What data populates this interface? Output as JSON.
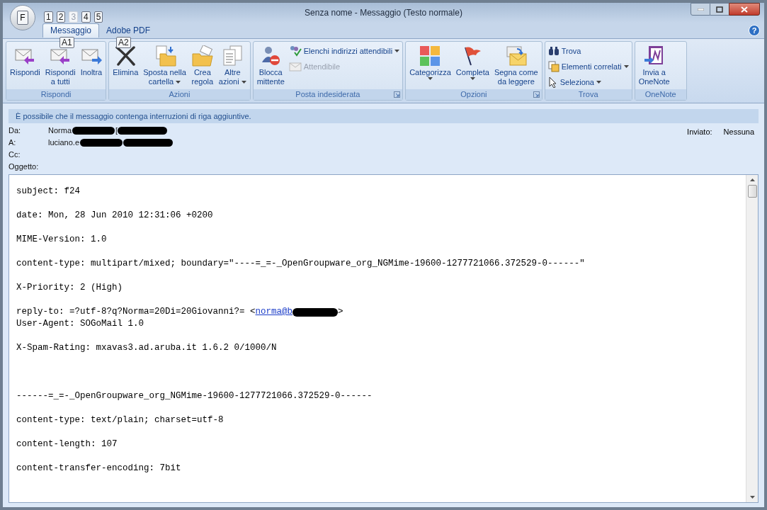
{
  "window": {
    "title": "Senza nome - Messaggio (Testo normale)",
    "office_button_keytip": "F",
    "quick_access_keytips": [
      {
        "label": "1",
        "disabled": false
      },
      {
        "label": "2",
        "disabled": false
      },
      {
        "label": "3",
        "disabled": true
      },
      {
        "label": "4",
        "disabled": false
      },
      {
        "label": "5",
        "disabled": false
      }
    ]
  },
  "tabs": [
    {
      "label": "Messaggio",
      "selected": true,
      "keytip": "A1"
    },
    {
      "label": "Adobe PDF",
      "selected": false,
      "keytip": "A2"
    }
  ],
  "ribbon": [
    {
      "name": "Rispondi",
      "launcher": false,
      "items": [
        {
          "kind": "large",
          "label": [
            "Rispondi"
          ],
          "dropdown": false,
          "disabled": false
        },
        {
          "kind": "large",
          "label": [
            "Rispondi",
            "a tutti"
          ],
          "dropdown": false,
          "disabled": false
        },
        {
          "kind": "large",
          "label": [
            "Inoltra"
          ],
          "dropdown": false,
          "disabled": false
        }
      ]
    },
    {
      "name": "Azioni",
      "launcher": false,
      "items": [
        {
          "kind": "large",
          "label": [
            "Elimina"
          ],
          "dropdown": false,
          "disabled": false
        },
        {
          "kind": "large",
          "label": [
            "Sposta nella",
            "cartella"
          ],
          "dropdown": true,
          "disabled": false
        },
        {
          "kind": "large",
          "label": [
            "Crea",
            "regola"
          ],
          "dropdown": false,
          "disabled": false
        },
        {
          "kind": "large",
          "label": [
            "Altre",
            "azioni"
          ],
          "dropdown": true,
          "disabled": false
        }
      ]
    },
    {
      "name": "Posta indesiderata",
      "launcher": true,
      "items": [
        {
          "kind": "large",
          "label": [
            "Blocca",
            "mittente"
          ],
          "dropdown": false,
          "disabled": false
        },
        {
          "kind": "small",
          "label": [
            "Elenchi indirizzi attendibili"
          ],
          "dropdown": true,
          "disabled": false
        },
        {
          "kind": "small",
          "label": [
            "Attendibile"
          ],
          "dropdown": false,
          "disabled": true
        }
      ]
    },
    {
      "name": "Opzioni",
      "launcher": true,
      "items": [
        {
          "kind": "large",
          "label": [
            "Categorizza"
          ],
          "dropdown": true,
          "disabled": false
        },
        {
          "kind": "large",
          "label": [
            "Completa"
          ],
          "dropdown": true,
          "disabled": false
        },
        {
          "kind": "large",
          "label": [
            "Segna come",
            "da leggere"
          ],
          "dropdown": false,
          "disabled": false
        }
      ]
    },
    {
      "name": "Trova",
      "launcher": false,
      "items": [
        {
          "kind": "small",
          "label": [
            "Trova"
          ],
          "dropdown": false,
          "disabled": false
        },
        {
          "kind": "small",
          "label": [
            "Elementi correlati"
          ],
          "dropdown": true,
          "disabled": false
        },
        {
          "kind": "small",
          "label": [
            "Seleziona"
          ],
          "dropdown": true,
          "disabled": false
        }
      ]
    },
    {
      "name": "OneNote",
      "launcher": false,
      "items": [
        {
          "kind": "large",
          "label": [
            "Invia a",
            "OneNote"
          ],
          "dropdown": false,
          "disabled": false
        }
      ]
    }
  ],
  "help_button": "?",
  "info_bar": "È possibile che il messaggio contenga interruzioni di riga aggiuntive.",
  "header": {
    "fields": [
      {
        "label": "Da:",
        "value": "Norma",
        "after": "[",
        "redacted": true
      },
      {
        "label": "A:",
        "value": "luciano.e",
        "redacted": true
      },
      {
        "label": "Cc:",
        "redacted": false
      },
      {
        "label": "Oggetto:",
        "redacted": false
      }
    ],
    "sent_label": "Inviato:",
    "sent_value": "Nessuna"
  },
  "body": [
    {
      "kind": "line",
      "text": "subject: f24"
    },
    {
      "kind": "line",
      "text": "date: Mon, 28 Jun 2010 12:31:06 +0200"
    },
    {
      "kind": "line",
      "text": "MIME-Version: 1.0"
    },
    {
      "kind": "line",
      "text": "content-type: multipart/mixed; boundary=\"----=_=-_OpenGroupware_org_NGMime-19600-1277721066.372529-0------\""
    },
    {
      "kind": "line",
      "text": "X-Priority: 2 (High)"
    },
    {
      "kind": "link_line",
      "text": "reply-to: =?utf-8?q?Norma=20Di=20Giovanni?= <",
      "link": "norma@b",
      "after": ">",
      "next": "User-Agent: SOGoMail 1.0"
    },
    {
      "kind": "line",
      "text": "X-Spam-Rating: mxavas3.ad.aruba.it 1.6.2 0/1000/N"
    },
    {
      "kind": "boundary",
      "text": "------=_=-_OpenGroupware_org_NGMime-19600-1277721066.372529-0------"
    },
    {
      "kind": "line",
      "text": "content-type: text/plain; charset=utf-8"
    },
    {
      "kind": "line",
      "text": "content-length: 107"
    },
    {
      "kind": "line",
      "text": "content-transfer-encoding: 7bit"
    }
  ]
}
